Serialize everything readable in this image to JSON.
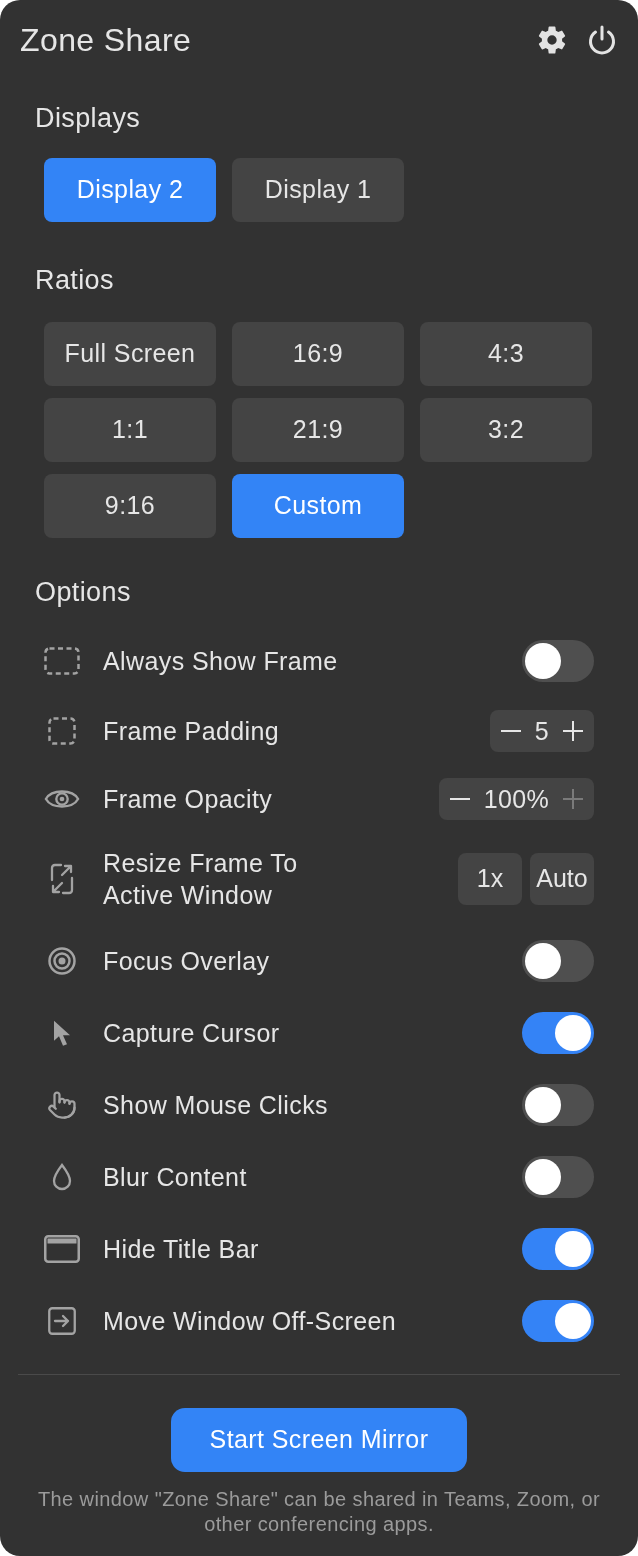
{
  "window": {
    "title": "Zone Share"
  },
  "displays": {
    "heading": "Displays",
    "options": [
      {
        "label": "Display 2",
        "selected": true
      },
      {
        "label": "Display 1",
        "selected": false
      }
    ]
  },
  "ratios": {
    "heading": "Ratios",
    "options": [
      {
        "label": "Full Screen",
        "selected": false
      },
      {
        "label": "16:9",
        "selected": false
      },
      {
        "label": "4:3",
        "selected": false
      },
      {
        "label": "1:1",
        "selected": false
      },
      {
        "label": "21:9",
        "selected": false
      },
      {
        "label": "3:2",
        "selected": false
      },
      {
        "label": "9:16",
        "selected": false
      },
      {
        "label": "Custom",
        "selected": true
      }
    ]
  },
  "options": {
    "heading": "Options",
    "items": [
      {
        "kind": "toggle",
        "label": "Always Show Frame",
        "on": false
      },
      {
        "kind": "stepper",
        "label": "Frame Padding",
        "value": "5",
        "increment_disabled": false
      },
      {
        "kind": "stepper",
        "label": "Frame Opacity",
        "value": "100%",
        "increment_disabled": true
      },
      {
        "kind": "buttons",
        "label": "Resize Frame To Active Window",
        "buttons": [
          "1x",
          "Auto"
        ]
      },
      {
        "kind": "toggle",
        "label": "Focus Overlay",
        "on": false
      },
      {
        "kind": "toggle",
        "label": "Capture Cursor",
        "on": true
      },
      {
        "kind": "toggle",
        "label": "Show Mouse Clicks",
        "on": false
      },
      {
        "kind": "toggle",
        "label": "Blur Content",
        "on": false
      },
      {
        "kind": "toggle",
        "label": "Hide Title Bar",
        "on": true
      },
      {
        "kind": "toggle",
        "label": "Move Window Off-Screen",
        "on": true
      }
    ]
  },
  "primary_action": "Start Screen Mirror",
  "footer_note": "The window \"Zone Share\" can be shared in Teams, Zoom, or other conferencing apps."
}
